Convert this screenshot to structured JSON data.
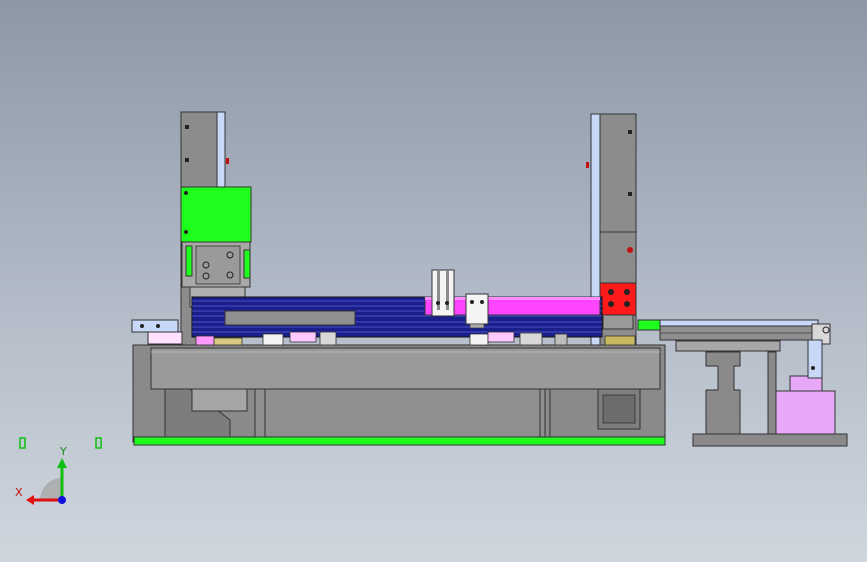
{
  "triad": {
    "x_label": "X",
    "y_label": "Y"
  },
  "colors": {
    "background_top": "#8d97a6",
    "background_bottom": "#cfd6de",
    "frame_gray": "#8a8a8a",
    "frame_dark": "#6f6f6f",
    "green": "#1eff1e",
    "blue_rails": "#1a1f8c",
    "magenta": "#ff44ff",
    "red_block": "#ff1a1a",
    "light_blue": "#c8d8f8",
    "lavender": "#e8a8f8",
    "axis_red": "#e01010",
    "axis_green": "#10c010",
    "axis_blue": "#1010e0"
  }
}
